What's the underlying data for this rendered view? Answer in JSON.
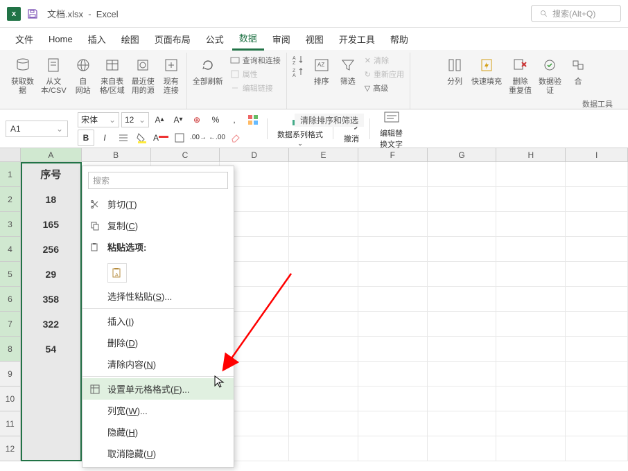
{
  "titlebar": {
    "filename": "文档.xlsx",
    "app": "Excel",
    "search_placeholder": "搜索(Alt+Q)"
  },
  "menubar": {
    "tabs": [
      "文件",
      "Home",
      "插入",
      "绘图",
      "页面布局",
      "公式",
      "数据",
      "审阅",
      "视图",
      "开发工具",
      "帮助"
    ],
    "active_index": 6
  },
  "ribbon": {
    "get_data": "获取数\n据",
    "from_text": "从文\n本/CSV",
    "from_web": "自\n网站",
    "from_table": "来自表\n格/区域",
    "recent": "最近使\n用的源",
    "existing": "现有\n连接",
    "refresh_all": "全部刷新",
    "queries": "查询和连接",
    "properties": "属性",
    "edit_links": "编辑链接",
    "sort_az": "A→Z",
    "sort_za": "Z→A",
    "sort": "排序",
    "filter": "筛选",
    "clear": "清除",
    "reapply": "重新应用",
    "advanced": "高级",
    "text_to_cols": "分列",
    "flash_fill": "快速填充",
    "remove_dup": "删除\n重复值",
    "data_valid": "数据验\n证",
    "consolidate": "合",
    "clear_filter": "清除排序和筛选",
    "data_tools_label": "数据工具"
  },
  "toolbar2": {
    "name_box": "A1",
    "font": "宋体",
    "size": "12",
    "format_series": "数据系列格式",
    "undo": "撤消",
    "edit_alt": "编辑替\n换文字"
  },
  "sheet": {
    "columns": [
      "A",
      "B",
      "C",
      "D",
      "E",
      "F",
      "G",
      "H",
      "I"
    ],
    "rows": [
      1,
      2,
      3,
      4,
      5,
      6,
      7,
      8,
      9,
      10,
      11,
      12
    ],
    "header_cell": "序号",
    "data": [
      18,
      165,
      256,
      29,
      358,
      322,
      54
    ]
  },
  "context_menu": {
    "search": "搜索",
    "cut": "剪切(T)",
    "copy": "复制(C)",
    "paste_options": "粘贴选项:",
    "paste_special": "选择性粘贴(S)...",
    "insert": "插入(I)",
    "delete": "删除(D)",
    "clear_contents": "清除内容(N)",
    "format_cells": "设置单元格格式(F)...",
    "column_width": "列宽(W)...",
    "hide": "隐藏(H)",
    "unhide": "取消隐藏(U)"
  }
}
